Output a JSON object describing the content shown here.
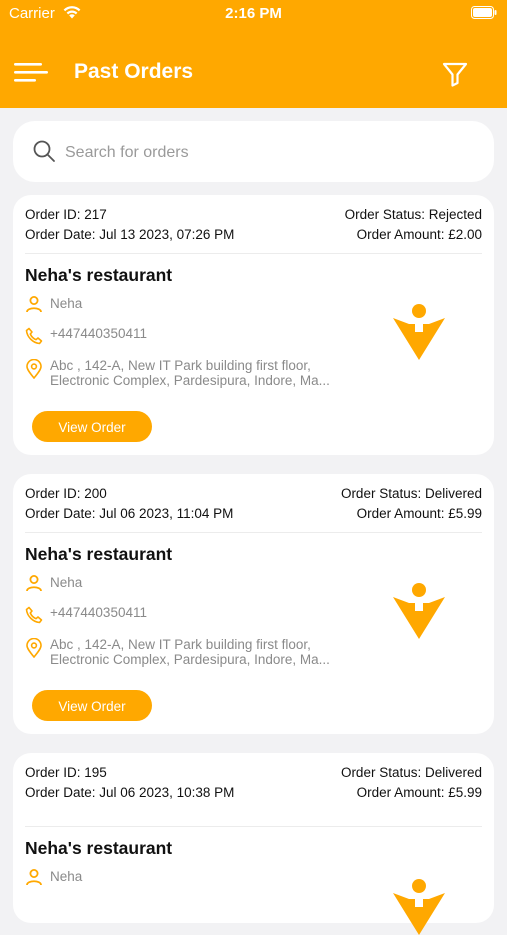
{
  "status_bar": {
    "carrier": "Carrier",
    "time": "2:16 PM"
  },
  "header": {
    "title": "Past Orders"
  },
  "search": {
    "placeholder": "Search for orders"
  },
  "orders": [
    {
      "order_id": "Order ID: 217",
      "order_date": "Order Date: Jul 13 2023, 07:26 PM",
      "order_status": "Order Status: Rejected",
      "order_amount": "Order Amount: £2.00",
      "restaurant": "Neha's restaurant",
      "customer": "Neha",
      "phone": "+447440350411",
      "address": "Abc , 142-A, New IT Park building first floor, Electronic Complex, Pardesipura, Indore, Ma...",
      "button": "View Order"
    },
    {
      "order_id": "Order ID: 200",
      "order_date": "Order Date: Jul 06 2023, 11:04 PM",
      "order_status": "Order Status: Delivered",
      "order_amount": "Order Amount: £5.99",
      "restaurant": "Neha's restaurant",
      "customer": "Neha",
      "phone": "+447440350411",
      "address": "Abc , 142-A, New IT Park building first floor, Electronic Complex, Pardesipura, Indore, Ma...",
      "button": "View Order"
    },
    {
      "order_id": "Order ID: 195",
      "order_date": "Order Date: Jul 06 2023, 10:38 PM",
      "order_status": "Order Status: Delivered",
      "order_amount": "Order Amount: £5.99",
      "restaurant": "Neha's restaurant",
      "customer": "Neha"
    }
  ],
  "icons": {
    "menu": "menu-icon",
    "filter": "filter-icon",
    "search": "search-icon",
    "person": "person-icon",
    "phone": "phone-icon",
    "location": "location-pin-icon",
    "logo": "restaurant-logo-icon"
  },
  "colors": {
    "accent": "#ffa800",
    "background": "#f2f2f4",
    "card": "#ffffff"
  }
}
